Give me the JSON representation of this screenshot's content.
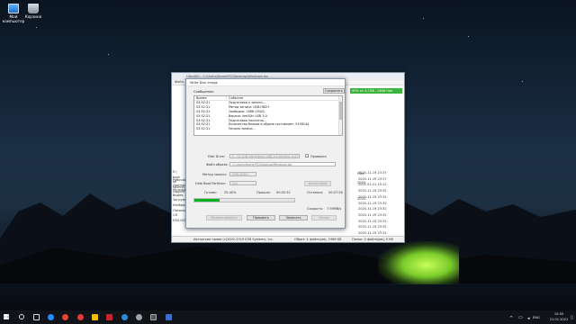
{
  "desktop": {
    "icons": [
      {
        "label": "Мой компьютер",
        "icon": "computer-icon"
      },
      {
        "label": "Корзина",
        "icon": "recycle-bin-icon"
      }
    ]
  },
  "explorer": {
    "title": "UltraISO - C:\\Users\\Home\\PC\\Desktop\\Windows.iso",
    "menu": "Файл",
    "disk_info": "99% от 4.7GB - 2846 free",
    "dates": [
      "2020-11-19 23:37",
      "2020-11-19 23:37",
      "2021-01-21 15:12",
      "2020-11-19 23:32",
      "2020-11-19 23:32",
      "2020-11-19 23:32",
      "2020-11-19 23:32",
      "2020-11-19 23:32",
      "2020-11-19 23:32",
      "2020-11-19 23:32",
      "2020-11-19 23:32"
    ],
    "tree_top": [
      "E:\\",
      "boot",
      "efi",
      "sources",
      "support",
      ""
    ],
    "tree_bottom": [
      "Рабочий",
      "Документы",
      "Музыка",
      "Видео",
      "Загрузки",
      "Изображения",
      "Локальный",
      "CD",
      "ESD-ISO (E:)"
    ],
    "files_label": "Files",
    "dates_bottom": [
      "2020-",
      "2020-"
    ],
    "status_copyright": "Авторские права (c)2002-2019 EZB Systems, Inc.",
    "status_files": "Образ: 4 файла(ов), 1986 KB",
    "status_count": "Папка: 0 файла(ов), 0 KB"
  },
  "dialog": {
    "title": "Write Disk Image",
    "messages_label": "Сообщения:",
    "save_label": "Сохранить",
    "log_headers": {
      "time": "Время",
      "event": "Событие"
    },
    "log": [
      {
        "time": "03:52:31",
        "event": "Подготовка к записи..."
      },
      {
        "time": "03:52:31",
        "event": "Метод записи: USB-HDD+"
      },
      {
        "time": "03:52:31",
        "event": "Свободно: 1986 (5542)"
      },
      {
        "time": "03:52:31",
        "event": "Версия: VeriSilic USB 3.0"
      },
      {
        "time": "03:52:31",
        "event": "Подготовка носителя..."
      },
      {
        "time": "03:52:31",
        "event": "Количество блоков в образе составляет: 9158144"
      },
      {
        "time": "03:52:31",
        "event": "Начало записи..."
      }
    ],
    "disk_drive_label": "Disk Drive:",
    "disk_drive_value": "F:, 15.1GB (VeriSilicon USB 3.0 VeriSilic_0.0)",
    "verify_label": "Проверка",
    "image_file_label": "Файл образа:",
    "image_file_value": "C:\\Users\\Home\\PC\\Desktop\\Windows.iso",
    "write_method_label": "Метод записи:",
    "write_method_value": "USB-HDD+",
    "hide_boot_label": "Hide Boot Partition:",
    "hide_boot_value": "Нет",
    "boot_btn": "Xpress Boot",
    "done_label": "Готово:",
    "done_value": "25.40%",
    "elapsed_label": "Прошло:",
    "elapsed_value": "00:02:32",
    "remaining_label": "Осталось:",
    "remaining_value": "00:07:26",
    "speed_label": "Скорость:",
    "speed_value": "7.90MB/s",
    "progress_fraction": 0.254,
    "btn_format": "Форматировать",
    "btn_abort": "Прервать",
    "btn_write": "Записать",
    "btn_back": "Назад"
  },
  "taskbar": {
    "language": "ENG",
    "time": "15:55",
    "date": "21.01.2021"
  }
}
